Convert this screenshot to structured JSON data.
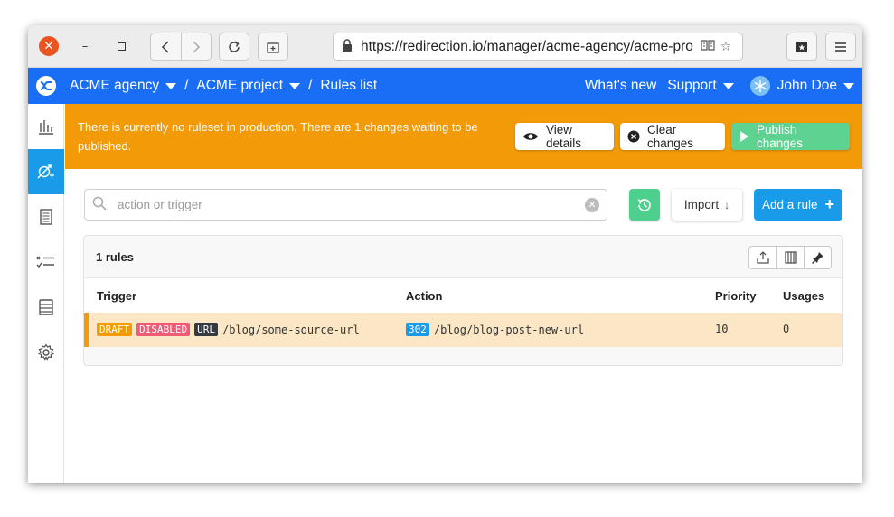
{
  "browser": {
    "url": "https://redirection.io/manager/acme-agency/acme-pro"
  },
  "topbar": {
    "organization": "ACME agency",
    "project": "ACME project",
    "separator": "/",
    "page": "Rules list",
    "whats_new": "What's new",
    "support": "Support",
    "user": "John Doe"
  },
  "banner": {
    "message": "There is currently no ruleset in production. There are 1 changes waiting to be published.",
    "view_details": "View details",
    "clear_changes": "Clear changes",
    "publish_changes": "Publish changes",
    "color": "#f29a07"
  },
  "toolbar": {
    "search_placeholder": "action or trigger",
    "import_label": "Import",
    "add_rule_label": "Add a rule"
  },
  "rules": {
    "count_label": "1 rules",
    "columns": {
      "trigger": "Trigger",
      "action": "Action",
      "priority": "Priority",
      "usages": "Usages"
    },
    "rows": [
      {
        "tags": [
          "DRAFT",
          "DISABLED",
          "URL"
        ],
        "source": "/blog/some-source-url",
        "status_code": "302",
        "target": "/blog/blog-post-new-url",
        "priority": "10",
        "usages": "0"
      }
    ]
  },
  "colors": {
    "brand_blue": "#1a6ef5",
    "accent_blue": "#1a9bea",
    "success_green": "#5ed391",
    "warning_orange": "#f29a07",
    "danger_pink": "#ed5c75"
  }
}
